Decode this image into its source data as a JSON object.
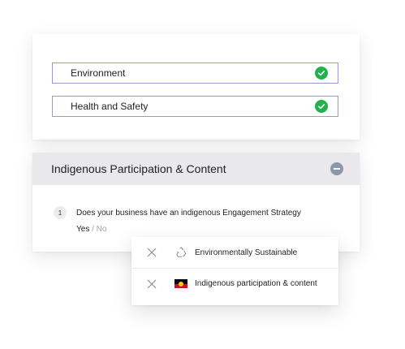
{
  "checklist": [
    {
      "label": "Environment",
      "status_icon": "check-circle-icon",
      "status_color": "#22b14c"
    },
    {
      "label": "Health and Safety",
      "status_icon": "check-circle-icon",
      "status_color": "#22b14c"
    }
  ],
  "section": {
    "title": "Indigenous Participation & Content",
    "collapse_icon": "minus-circle-icon"
  },
  "question": {
    "number": "1",
    "text": "Does your business have an indigenous Engagement Strategy",
    "answer_selected": "Yes",
    "answer_separator": "/",
    "answer_other": "No"
  },
  "tags": [
    {
      "label": "Environmentally Sustainable",
      "icon": "recycle-icon",
      "remove_icon": "close-icon"
    },
    {
      "label": "Indigenous participation & content",
      "icon": "aboriginal-flag-icon",
      "remove_icon": "close-icon"
    }
  ],
  "colors": {
    "success": "#22b14c",
    "header_bg": "#e9e9ec",
    "muted": "#a0a4ab",
    "flag_red": "#c8102e",
    "flag_yellow": "#ffcd00"
  }
}
